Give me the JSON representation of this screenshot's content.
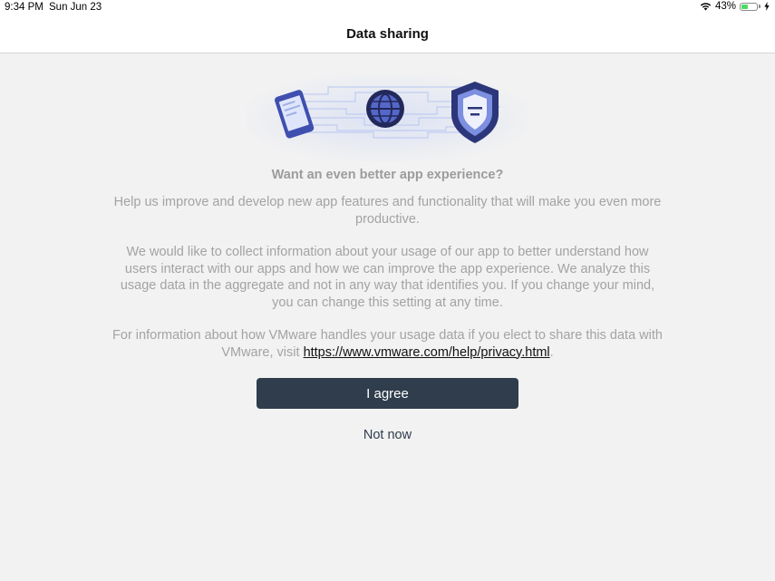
{
  "status_bar": {
    "time": "9:34 PM",
    "date": "Sun Jun 23",
    "battery_percent": "43%",
    "battery_level": 0.43,
    "icons": [
      "wifi-icon",
      "battery-icon",
      "charging-bolt-icon"
    ]
  },
  "nav": {
    "title": "Data sharing"
  },
  "hero": {
    "icons": [
      "phone-icon",
      "globe-icon",
      "shield-icon"
    ],
    "accent_color": "#3f51b5"
  },
  "content": {
    "headline": "Want an even better app experience?",
    "paragraph_1": "Help us improve and develop new app features and functionality that will make you even more productive.",
    "paragraph_2": "We would like to collect information about your usage of our app to better understand how users interact with our apps and how we can improve the app experience. We analyze this usage data in the aggregate and not in any way that identifies you. If you change your mind, you can change this setting at any time.",
    "paragraph_3_prefix": "For information about how VMware handles your usage data if you elect to share this data with VMware, visit ",
    "privacy_link": "https://www.vmware.com/help/privacy.html",
    "paragraph_3_suffix": "."
  },
  "actions": {
    "agree_label": "I agree",
    "not_now_label": "Not now"
  },
  "colors": {
    "primary_button": "#2f3d4c",
    "background": "#f2f2f2",
    "muted_text": "#a3a3a3"
  }
}
